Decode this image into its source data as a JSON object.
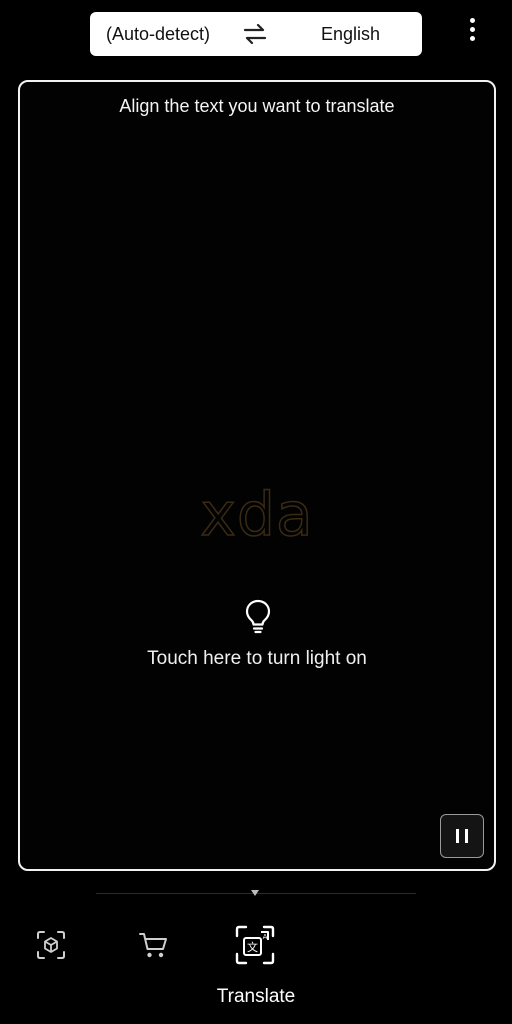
{
  "language_bar": {
    "source_language": "(Auto-detect)",
    "target_language": "English",
    "swap_icon": "swap-arrows-icon"
  },
  "menu": {
    "icon": "more-vert-icon"
  },
  "viewfinder": {
    "instruction": "Align the text you want to translate",
    "watermark": "xda",
    "light_icon": "lightbulb-icon",
    "light_hint": "Touch here to turn light on",
    "pause_icon": "pause-icon"
  },
  "bottom_nav": {
    "tabs": [
      {
        "icon": "lens-scan-icon",
        "active": false
      },
      {
        "icon": "shopping-cart-icon",
        "active": false
      },
      {
        "icon": "translate-icon",
        "active": true,
        "label": "Translate"
      }
    ]
  },
  "colors": {
    "background": "#000000",
    "frame_border": "#f2f2f2",
    "language_bar": "#ffffff",
    "watermark": "#3a2a14"
  }
}
